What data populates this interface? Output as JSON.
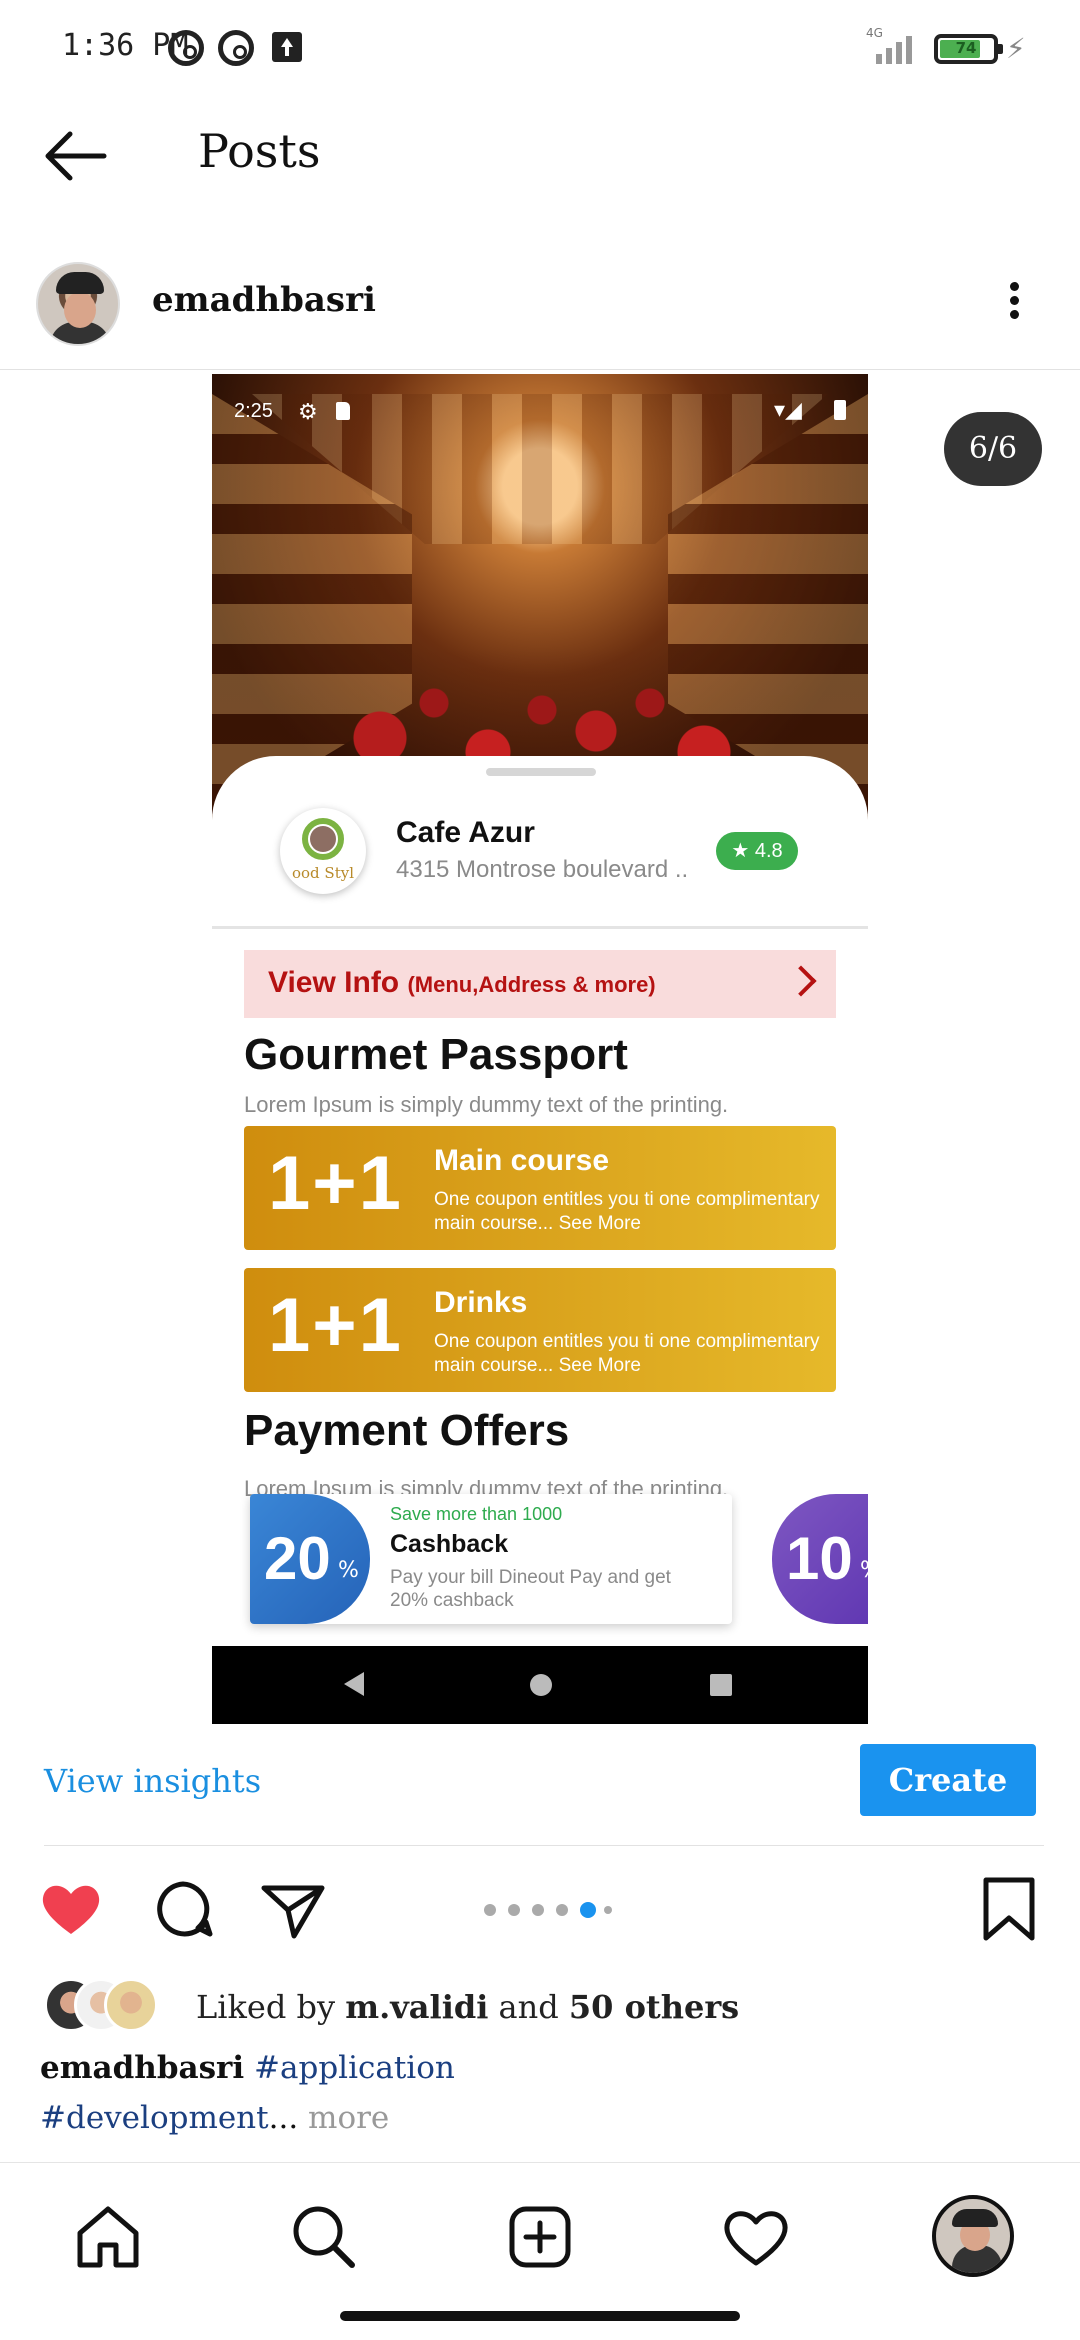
{
  "status_bar": {
    "time": "1:36 PM",
    "network": "4G",
    "battery_level": "74",
    "icons": [
      "do-not-disturb-icon",
      "do-not-disturb-icon",
      "upload-icon",
      "signal-icon",
      "battery-icon",
      "charging-icon"
    ]
  },
  "app_bar": {
    "title": "Posts",
    "back_icon": "arrow-left-icon"
  },
  "post": {
    "username": "emadhbasri",
    "more_icon": "vertical-dots-icon",
    "counter": "6/6",
    "media": {
      "inner_status_time": "2:25",
      "cafe_name": "Cafe Azur",
      "cafe_address": "4315 Montrose boulevard ..",
      "cafe_logo_text": "ood Styl",
      "rating": "★ 4.8",
      "view_info_title": "View Info",
      "view_info_sub": "(Menu,Address & more)",
      "gourmet_title": "Gourmet Passport",
      "gourmet_sub": "Lorem Ipsum is simply dummy text of the printing.",
      "coupons": [
        {
          "big": "1+1",
          "title": "Main course",
          "desc": "One coupon entitles you ti one complimentary main course... See More"
        },
        {
          "big": "1+1",
          "title": "Drinks",
          "desc": "One coupon entitles you ti one complimentary main course... See More"
        }
      ],
      "payment_title": "Payment Offers",
      "payment_sub": "Lorem Ipsum is simply dummy text of the printing.",
      "payment_card": {
        "num": "20",
        "pct": "%",
        "save": "Save more than 1000",
        "title": "Cashback",
        "desc": "Pay your bill Dineout Pay and get 20% cashback"
      },
      "payment_card2": {
        "num": "10",
        "pct": "%"
      }
    },
    "view_insights": "View insights",
    "create_ad": "Create Ad",
    "carousel": {
      "total": 6,
      "active": 5
    },
    "likes": {
      "prefix": "Liked by",
      "user": "m.validi",
      "and": "and",
      "others": "50 others"
    },
    "caption": {
      "user": "emadhbasri",
      "tag1": "#application",
      "tag2": "#development",
      "ellipsis": "...",
      "more": "more"
    }
  },
  "colors": {
    "like_red": "#f04050",
    "accent_blue": "#1a93ef",
    "coupon_gold": "#dba51e",
    "rating_green": "#3cae4e"
  }
}
